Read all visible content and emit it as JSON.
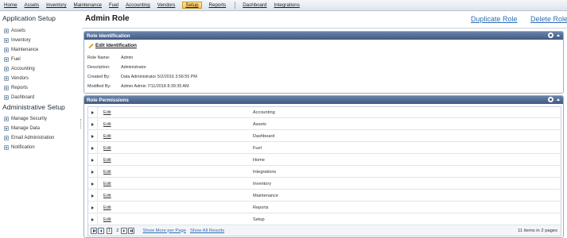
{
  "menu": {
    "items": [
      "Home",
      "Assets",
      "Inventory",
      "Maintenance",
      "Fuel",
      "Accounting",
      "Vendors",
      "Setup",
      "Reports",
      "Dashboard",
      "Integrations"
    ],
    "active": "Setup"
  },
  "sidebar": {
    "application_heading": "Application Setup",
    "application_items": [
      "Assets",
      "Inventory",
      "Maintenance",
      "Fuel",
      "Accounting",
      "Vendors",
      "Reports",
      "Dashboard"
    ],
    "admin_heading": "Administrative Setup",
    "admin_items": [
      "Manage Security",
      "Manage Data",
      "Email Administration",
      "Notification"
    ]
  },
  "header": {
    "title": "Admin Role",
    "duplicate_label": "Duplicate Role",
    "delete_label": "Delete Role"
  },
  "role_identification": {
    "title": "Role Identification",
    "edit_label": "Edit Identification",
    "fields": [
      {
        "label": "Role Name:",
        "value": "Admin"
      },
      {
        "label": "Description:",
        "value": "Administrator"
      },
      {
        "label": "Created By:",
        "value": "Data Administrator 5/2/2016 3:56:55 PM"
      },
      {
        "label": "Modified By:",
        "value": "Admin Admin 7/11/2018 8:39:35 AM"
      }
    ]
  },
  "role_permissions": {
    "title": "Role Permissions",
    "edit_label": "Edit",
    "rows": [
      "Accounting",
      "Assets",
      "Dashboard",
      "Fuel",
      "Home",
      "Integrations",
      "Inventory",
      "Maintenance",
      "Reports",
      "Setup"
    ],
    "pager": {
      "pages": [
        "1",
        "2"
      ],
      "current_page": "1",
      "show_more_label": "Show More per Page",
      "show_all_label": "Show All Results",
      "summary": "11 items in 2 pages"
    }
  },
  "colors": {
    "panel_header": "#3f5a84",
    "link": "#2d6db5",
    "active_menu": "#f6c24f"
  }
}
